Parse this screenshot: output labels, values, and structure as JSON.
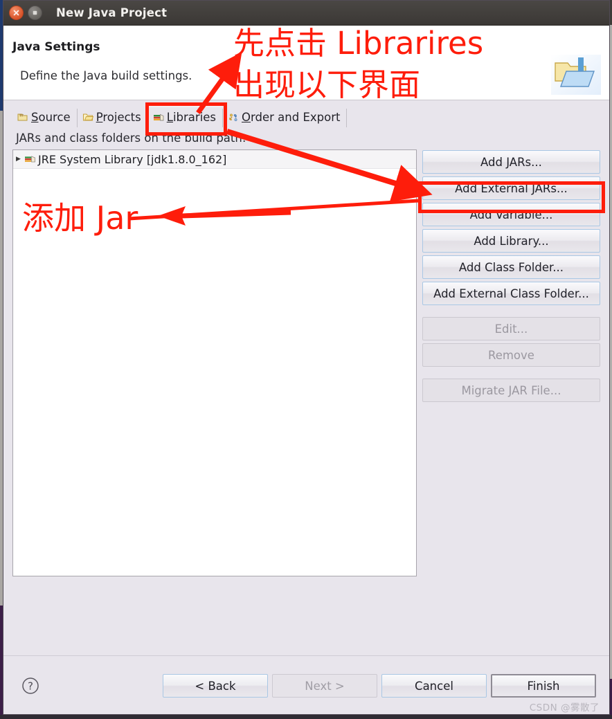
{
  "window": {
    "title": "New Java Project",
    "close_icon": "close-icon",
    "maximize_icon": "maximize-icon"
  },
  "wizard": {
    "title": "Java Settings",
    "description": "Define the Java build settings.",
    "banner_icon": "java-project-folder-icon"
  },
  "tabs": [
    {
      "label": "Source",
      "mnemonic": "S",
      "rest": "ource",
      "icon": "source-folder-icon",
      "selected": false
    },
    {
      "label": "Projects",
      "mnemonic": "P",
      "rest": "rojects",
      "icon": "projects-folder-icon",
      "selected": false
    },
    {
      "label": "Libraries",
      "mnemonic": "L",
      "rest": "ibraries",
      "icon": "libraries-books-icon",
      "selected": true
    },
    {
      "label": "Order and Export",
      "mnemonic": "O",
      "rest": "rder and Export",
      "icon": "order-export-icon",
      "selected": false
    }
  ],
  "content": {
    "list_label": "JARs and class folders on the build path:",
    "tree": [
      {
        "label": "JRE System Library [jdk1.8.0_162]",
        "icon": "libraries-books-icon",
        "expander": "collapsed-arrow-icon"
      }
    ]
  },
  "side_buttons": [
    {
      "label": "Add JARs...",
      "enabled": true
    },
    {
      "label": "Add External JARs...",
      "enabled": true
    },
    {
      "label": "Add Variable...",
      "enabled": true
    },
    {
      "label": "Add Library...",
      "enabled": true
    },
    {
      "label": "Add Class Folder...",
      "enabled": true
    },
    {
      "label": "Add External Class Folder...",
      "enabled": true
    },
    {
      "label": "Edit...",
      "enabled": false
    },
    {
      "label": "Remove",
      "enabled": false
    },
    {
      "label": "Migrate JAR File...",
      "enabled": false
    }
  ],
  "footer": {
    "help_icon": "help-question-icon",
    "buttons": [
      {
        "label": "< Back",
        "enabled": true,
        "default": false
      },
      {
        "label": "Next >",
        "enabled": false,
        "default": false
      },
      {
        "label": "Cancel",
        "enabled": true,
        "default": false
      },
      {
        "label": "Finish",
        "enabled": true,
        "default": true
      }
    ]
  },
  "annotations": {
    "color": "#fe1d0b",
    "line1": "先点击 Librarires",
    "line2": "出现以下界面",
    "line3": "添加 Jar",
    "highlight_libraries_tab": true,
    "highlight_add_external_jars": true
  },
  "watermark": "CSDN @雾散了"
}
